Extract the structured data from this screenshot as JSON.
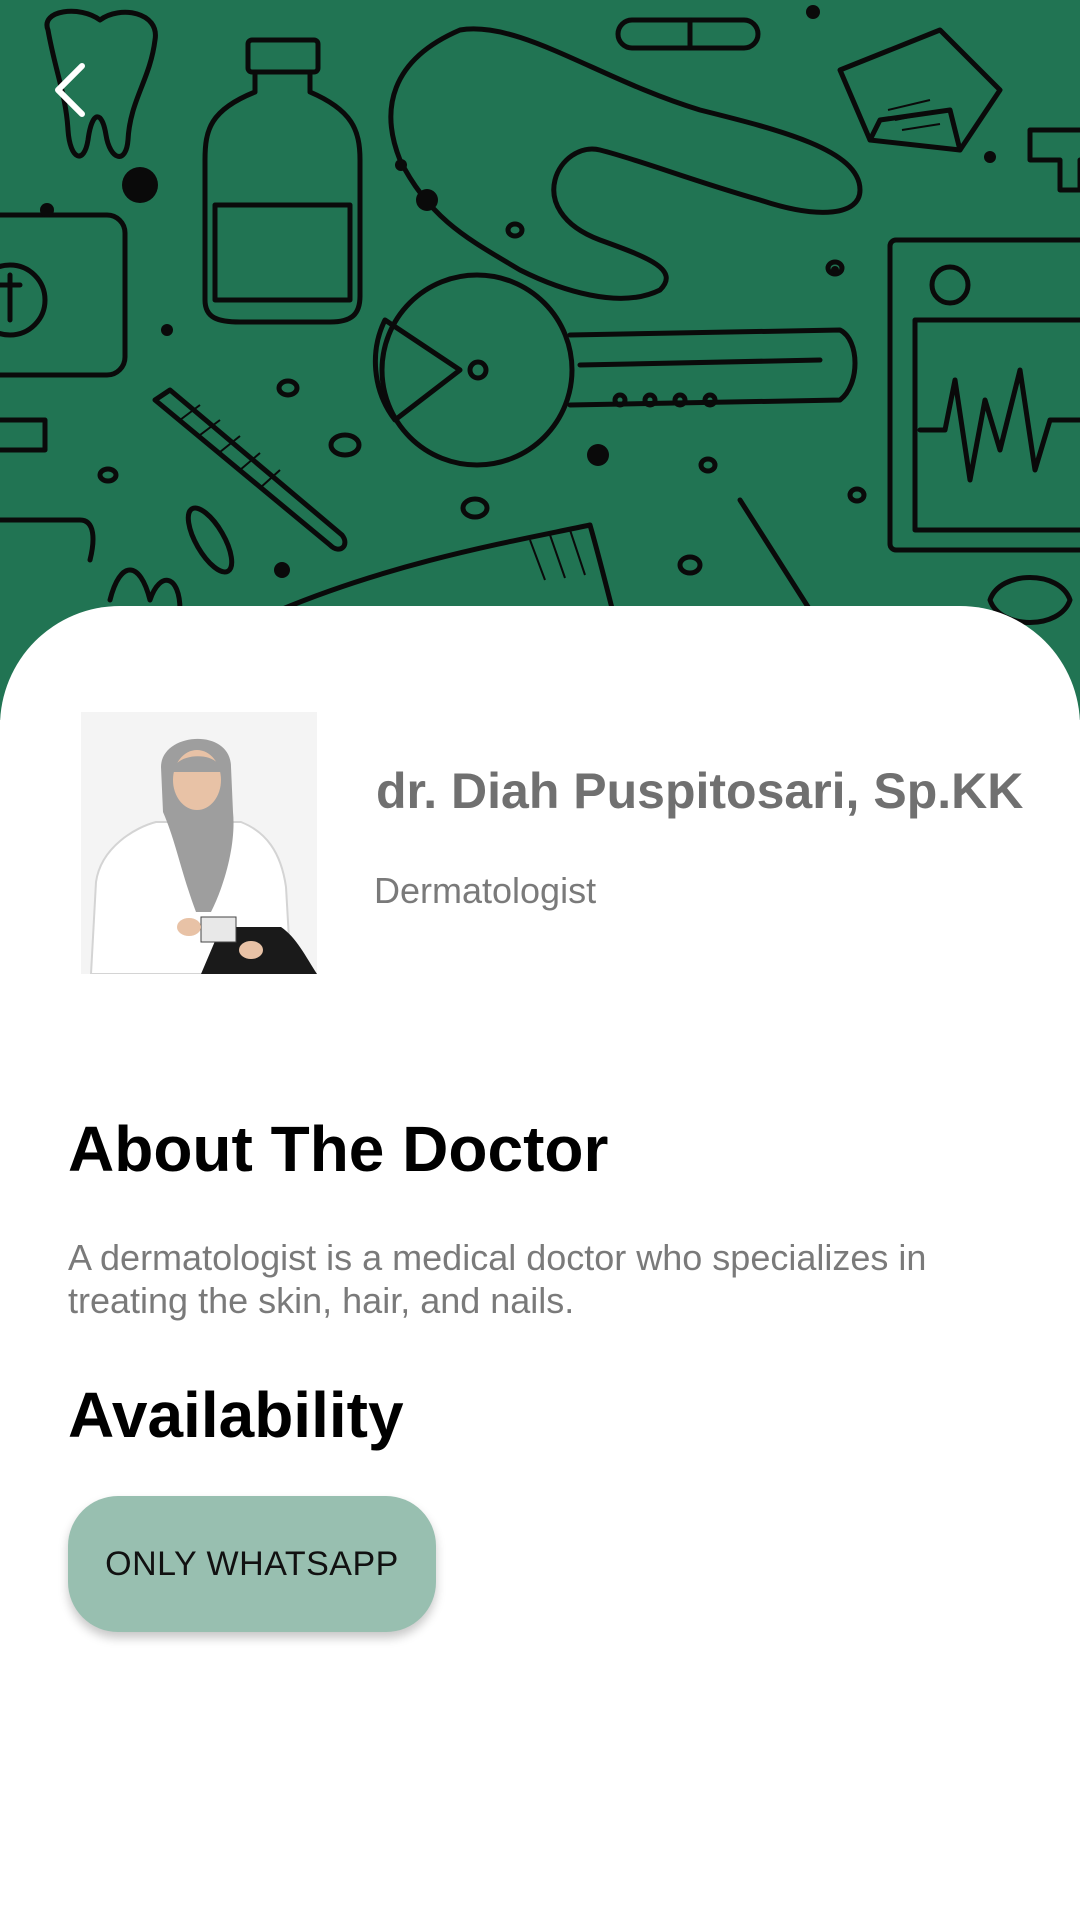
{
  "colors": {
    "header_green": "#217453",
    "button_bg": "#98bfb0",
    "name_gray": "#707070",
    "text_gray": "#7a7a7a"
  },
  "header": {
    "back_icon": "chevron-left-icon",
    "background_pattern": "medical-doodle-pattern"
  },
  "doctor": {
    "name": "dr. Diah Puspitosari, Sp.KK",
    "specialty": "Dermatologist",
    "photo": "doctor-portrait"
  },
  "about": {
    "title": "About The Doctor",
    "text": "A dermatologist is a medical doctor who specializes in treating the skin, hair, and nails."
  },
  "availability": {
    "title": "Availability",
    "button_label": "ONLY WHATSAPP"
  }
}
